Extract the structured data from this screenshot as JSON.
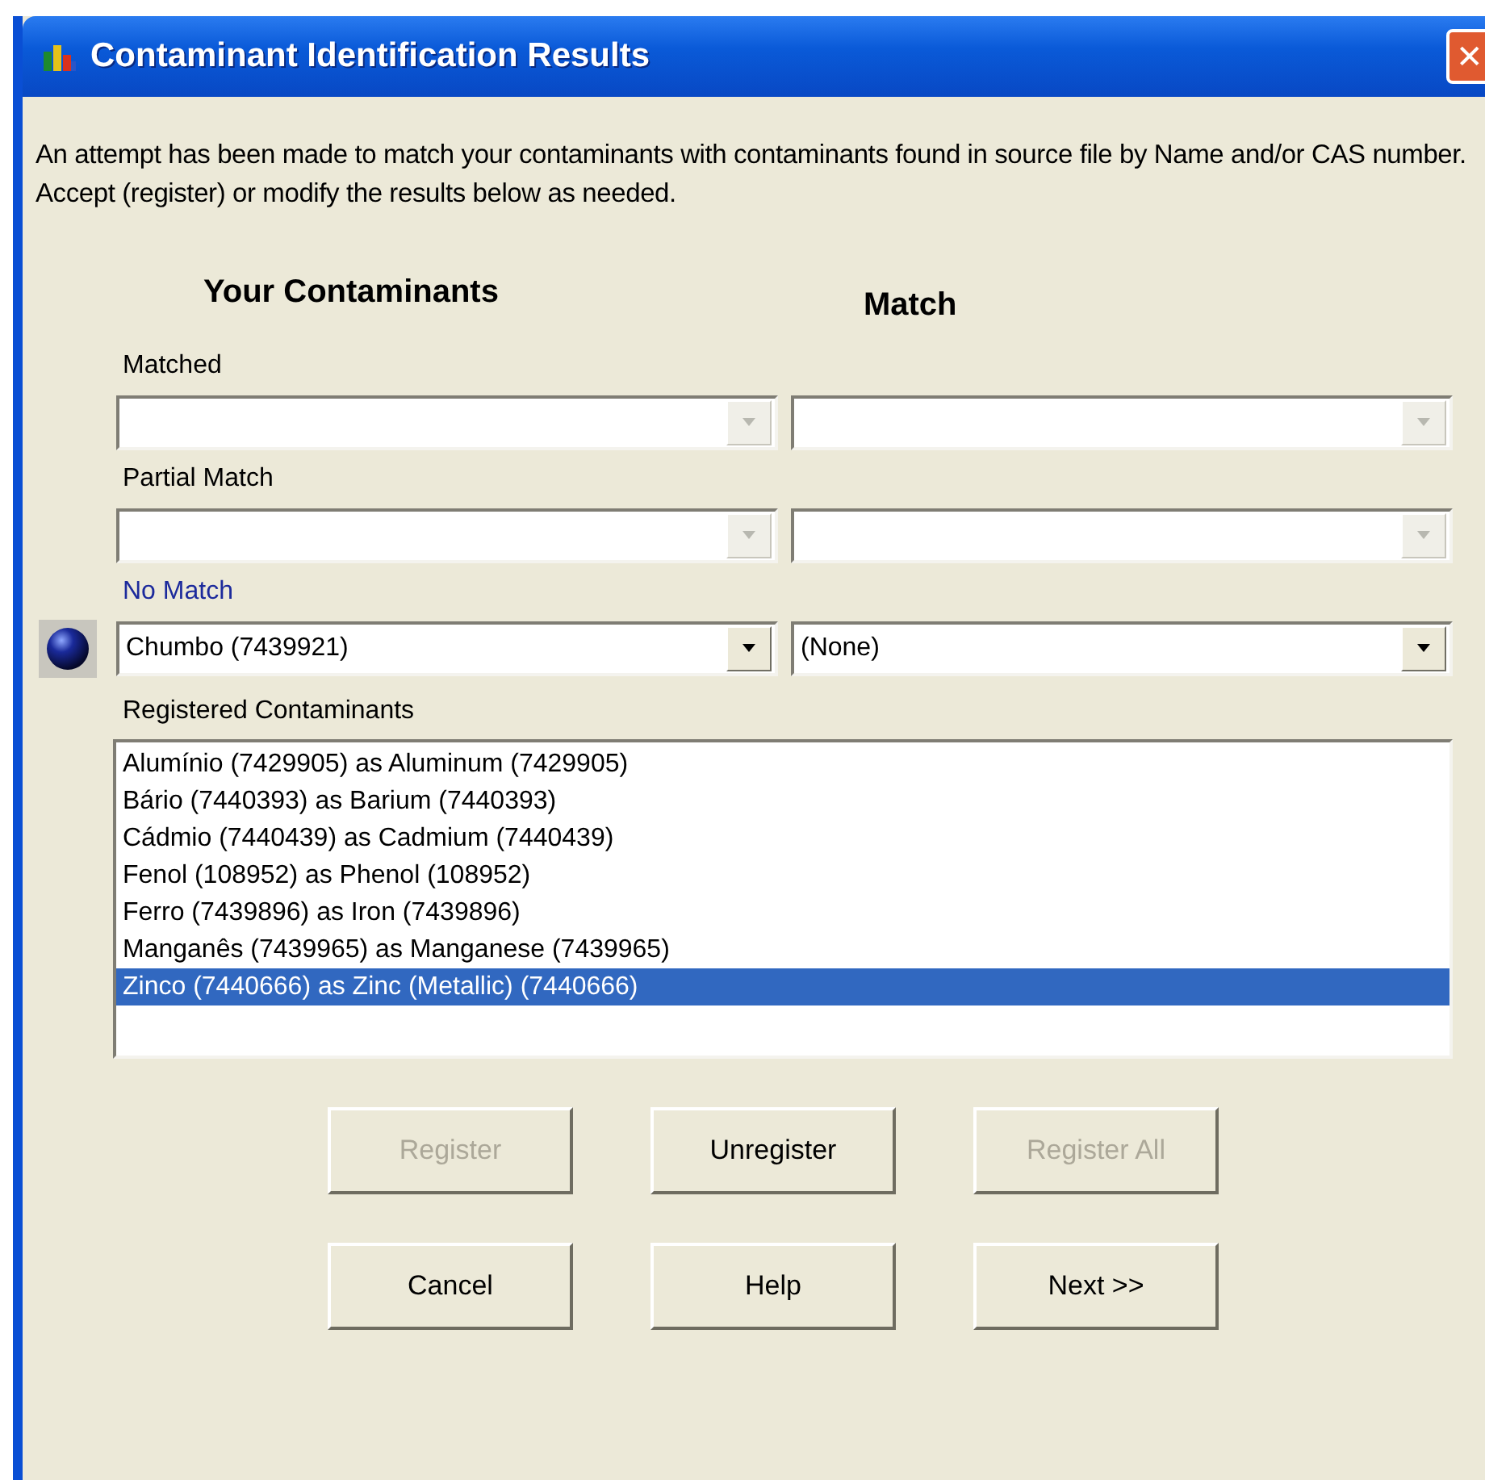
{
  "window": {
    "title": "Contaminant Identification Results",
    "close": "✕"
  },
  "description": "An attempt has been made to match your contaminants with contaminants found in source file by Name and/or CAS number.  Accept (register) or modify the results below as needed.",
  "column_headers": [
    "Your Contaminants",
    "Match"
  ],
  "groups": [
    {
      "label": "Matched",
      "selected": false,
      "left": {
        "disabled": true
      },
      "right": {
        "disabled": true
      }
    },
    {
      "label": "Partial Match",
      "selected": false,
      "left": {
        "disabled": true
      },
      "right": {
        "disabled": true
      }
    },
    {
      "label": "No Match",
      "selected": true,
      "left": {
        "value": "Chumbo (7439921)",
        "disabled": false
      },
      "right": {
        "value": "(None)",
        "disabled": false
      }
    }
  ],
  "registered": {
    "label": "Registered Contaminants",
    "items": [
      {
        "text": "Alumínio (7429905) as Aluminum (7429905)",
        "selected": false
      },
      {
        "text": "Bário (7440393) as Barium (7440393)",
        "selected": false
      },
      {
        "text": "Cádmio (7440439) as Cadmium (7440439)",
        "selected": false
      },
      {
        "text": "Fenol (108952) as Phenol (108952)",
        "selected": false
      },
      {
        "text": "Ferro (7439896) as Iron (7439896)",
        "selected": false
      },
      {
        "text": "Manganês (7439965) as Manganese (7439965)",
        "selected": false
      },
      {
        "text": "Zinco (7440666) as Zinc (Metallic) (7440666)",
        "selected": true
      }
    ]
  },
  "action_buttons": [
    {
      "label": "Register",
      "disabled": true
    },
    {
      "label": "Unregister",
      "disabled": false
    },
    {
      "label": "Register All",
      "disabled": true
    }
  ],
  "footer_buttons": [
    {
      "label": "Cancel",
      "disabled": false
    },
    {
      "label": "Help",
      "disabled": false
    },
    {
      "label": "Next >>",
      "disabled": false
    }
  ]
}
